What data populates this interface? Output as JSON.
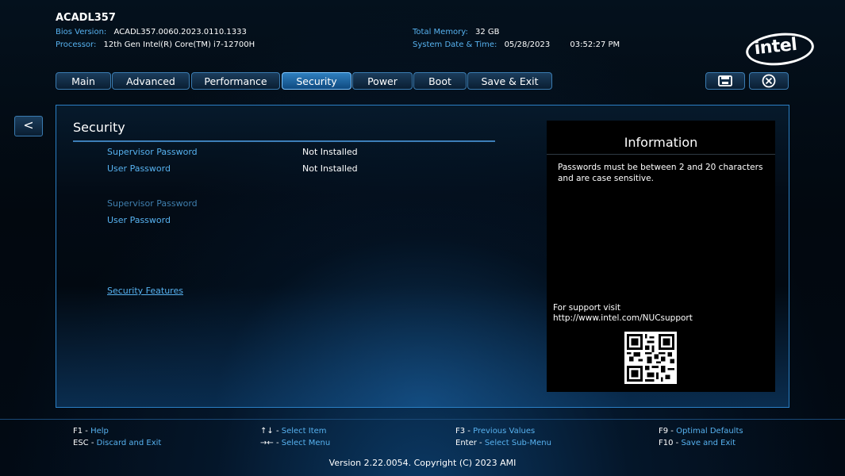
{
  "header": {
    "model": "ACADL357",
    "bios_version_label": "Bios Version:",
    "bios_version": "ACADL357.0060.2023.0110.1333",
    "processor_label": "Processor:",
    "processor": "12th Gen Intel(R) Core(TM) i7-12700H",
    "total_memory_label": "Total Memory:",
    "total_memory": "32 GB",
    "system_date_label": "System Date & Time:",
    "system_date": "05/28/2023",
    "system_time": "03:52:27 PM",
    "logo_text": "intel"
  },
  "tabs": [
    {
      "label": "Main"
    },
    {
      "label": "Advanced"
    },
    {
      "label": "Performance"
    },
    {
      "label": "Security"
    },
    {
      "label": "Power"
    },
    {
      "label": "Boot"
    },
    {
      "label": "Save & Exit"
    }
  ],
  "active_tab": "Security",
  "toolbar": {
    "save_icon": "save-icon",
    "close_icon": "close-icon"
  },
  "back_label": "<",
  "section": {
    "title": "Security",
    "status_rows": [
      {
        "label": "Supervisor Password",
        "value": "Not Installed"
      },
      {
        "label": "User Password",
        "value": "Not Installed"
      }
    ],
    "setting_rows": [
      {
        "label": "Supervisor Password"
      },
      {
        "label": "User Password"
      }
    ],
    "submenu_link": "Security Features"
  },
  "info": {
    "title": "Information",
    "text": "Passwords must be between 2 and 20 characters and are case sensitive.",
    "support_line1": "For support visit",
    "support_line2": "http://www.intel.com/NUCsupport"
  },
  "footer": {
    "f1_key": "F1",
    "f1_action": "Help",
    "esc_key": "ESC",
    "esc_action": "Discard and Exit",
    "arrows_key": "↑↓",
    "arrows_action": "Select Item",
    "lr_key": "→←",
    "lr_action": "Select Menu",
    "f3_key": "F3",
    "f3_action": "Previous Values",
    "enter_key": "Enter",
    "enter_action": "Select Sub-Menu",
    "f9_key": "F9",
    "f9_action": "Optimal Defaults",
    "f10_key": "F10",
    "f10_action": "Save and Exit",
    "version": "Version 2.22.0054. Copyright (C) 2023 AMI"
  },
  "colors": {
    "accent": "#57b2f0",
    "tab_active": "#2f7fbf",
    "border": "#3a7bb0",
    "background": "#02070d"
  }
}
